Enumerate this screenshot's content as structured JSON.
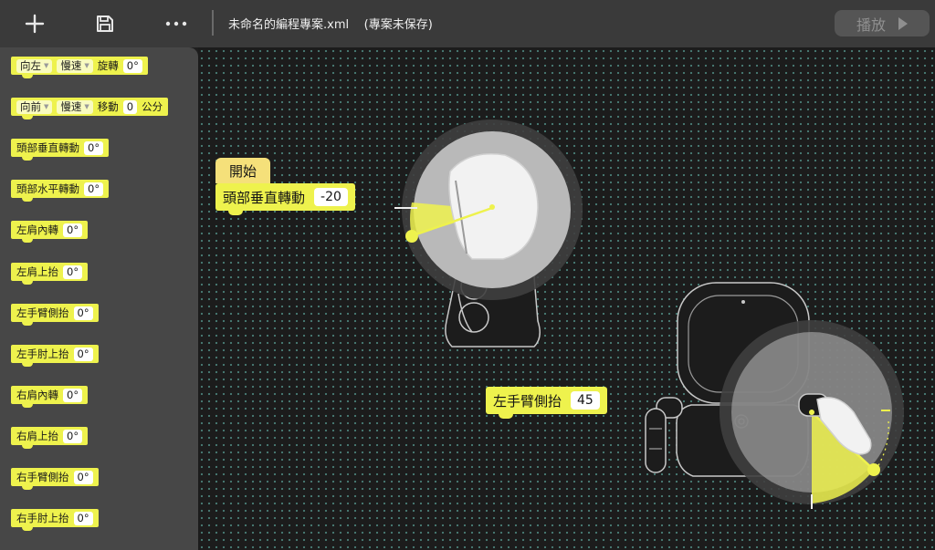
{
  "toolbar": {
    "add_icon": "plus-icon",
    "save_icon": "floppy-disk-icon",
    "more_icon": "ellipsis-icon",
    "file_title": "未命名的編程專案.xml    (專案未保存)",
    "play_label": "播放"
  },
  "palette": {
    "b1": {
      "dd1": "向左",
      "dd2": "慢速",
      "label": "旋轉",
      "value": "0°"
    },
    "b2": {
      "dd1": "向前",
      "dd2": "慢速",
      "label": "移動",
      "value": "0",
      "unit": "公分"
    },
    "b3": {
      "label": "頭部垂直轉動",
      "value": "0°"
    },
    "b4": {
      "label": "頭部水平轉動",
      "value": "0°"
    },
    "b5": {
      "label": "左肩內轉",
      "value": "0°"
    },
    "b6": {
      "label": "左肩上抬",
      "value": "0°"
    },
    "b7": {
      "label": "左手臂側抬",
      "value": "0°"
    },
    "b8": {
      "label": "左手肘上抬",
      "value": "0°"
    },
    "b9": {
      "label": "右肩內轉",
      "value": "0°"
    },
    "b10": {
      "label": "右肩上抬",
      "value": "0°"
    },
    "b11": {
      "label": "右手臂側抬",
      "value": "0°"
    },
    "b12": {
      "label": "右手肘上抬",
      "value": "0°"
    }
  },
  "workspace": {
    "start_label": "開始",
    "head_block": {
      "label": "頭部垂直轉動",
      "value": "-20"
    },
    "arm_block": {
      "label": "左手臂側抬",
      "value": "45"
    }
  },
  "colors": {
    "accent": "#eef24d",
    "hat": "#f5e07a",
    "topbar": "#3a3a3a",
    "sidebar": "#474747"
  }
}
